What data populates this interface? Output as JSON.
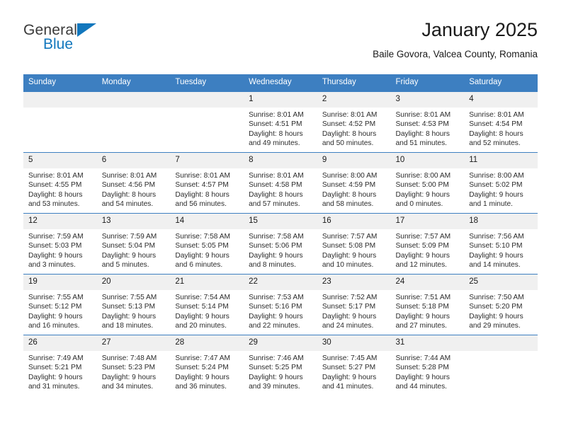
{
  "brand": {
    "name_part1": "General",
    "name_part2": "Blue",
    "triangle_icon": "triangle-icon",
    "accent_color": "#1277bd"
  },
  "header": {
    "title": "January 2025",
    "subtitle": "Baile Govora, Valcea County, Romania"
  },
  "theme": {
    "header_bar_color": "#3d7fc1",
    "daynum_band_color": "#f0f0f0",
    "text_color": "#2b2b2b"
  },
  "calendar": {
    "weekday_headers": [
      "Sunday",
      "Monday",
      "Tuesday",
      "Wednesday",
      "Thursday",
      "Friday",
      "Saturday"
    ],
    "labels": {
      "sunrise": "Sunrise:",
      "sunset": "Sunset:",
      "daylight": "Daylight:"
    },
    "weeks": [
      [
        {
          "day": "",
          "sunrise": "",
          "sunset": "",
          "daylight": "",
          "empty": true
        },
        {
          "day": "",
          "sunrise": "",
          "sunset": "",
          "daylight": "",
          "empty": true
        },
        {
          "day": "",
          "sunrise": "",
          "sunset": "",
          "daylight": "",
          "empty": true
        },
        {
          "day": "1",
          "sunrise": "Sunrise: 8:01 AM",
          "sunset": "Sunset: 4:51 PM",
          "daylight": "Daylight: 8 hours and 49 minutes."
        },
        {
          "day": "2",
          "sunrise": "Sunrise: 8:01 AM",
          "sunset": "Sunset: 4:52 PM",
          "daylight": "Daylight: 8 hours and 50 minutes."
        },
        {
          "day": "3",
          "sunrise": "Sunrise: 8:01 AM",
          "sunset": "Sunset: 4:53 PM",
          "daylight": "Daylight: 8 hours and 51 minutes."
        },
        {
          "day": "4",
          "sunrise": "Sunrise: 8:01 AM",
          "sunset": "Sunset: 4:54 PM",
          "daylight": "Daylight: 8 hours and 52 minutes."
        }
      ],
      [
        {
          "day": "5",
          "sunrise": "Sunrise: 8:01 AM",
          "sunset": "Sunset: 4:55 PM",
          "daylight": "Daylight: 8 hours and 53 minutes."
        },
        {
          "day": "6",
          "sunrise": "Sunrise: 8:01 AM",
          "sunset": "Sunset: 4:56 PM",
          "daylight": "Daylight: 8 hours and 54 minutes."
        },
        {
          "day": "7",
          "sunrise": "Sunrise: 8:01 AM",
          "sunset": "Sunset: 4:57 PM",
          "daylight": "Daylight: 8 hours and 56 minutes."
        },
        {
          "day": "8",
          "sunrise": "Sunrise: 8:01 AM",
          "sunset": "Sunset: 4:58 PM",
          "daylight": "Daylight: 8 hours and 57 minutes."
        },
        {
          "day": "9",
          "sunrise": "Sunrise: 8:00 AM",
          "sunset": "Sunset: 4:59 PM",
          "daylight": "Daylight: 8 hours and 58 minutes."
        },
        {
          "day": "10",
          "sunrise": "Sunrise: 8:00 AM",
          "sunset": "Sunset: 5:00 PM",
          "daylight": "Daylight: 9 hours and 0 minutes."
        },
        {
          "day": "11",
          "sunrise": "Sunrise: 8:00 AM",
          "sunset": "Sunset: 5:02 PM",
          "daylight": "Daylight: 9 hours and 1 minute."
        }
      ],
      [
        {
          "day": "12",
          "sunrise": "Sunrise: 7:59 AM",
          "sunset": "Sunset: 5:03 PM",
          "daylight": "Daylight: 9 hours and 3 minutes."
        },
        {
          "day": "13",
          "sunrise": "Sunrise: 7:59 AM",
          "sunset": "Sunset: 5:04 PM",
          "daylight": "Daylight: 9 hours and 5 minutes."
        },
        {
          "day": "14",
          "sunrise": "Sunrise: 7:58 AM",
          "sunset": "Sunset: 5:05 PM",
          "daylight": "Daylight: 9 hours and 6 minutes."
        },
        {
          "day": "15",
          "sunrise": "Sunrise: 7:58 AM",
          "sunset": "Sunset: 5:06 PM",
          "daylight": "Daylight: 9 hours and 8 minutes."
        },
        {
          "day": "16",
          "sunrise": "Sunrise: 7:57 AM",
          "sunset": "Sunset: 5:08 PM",
          "daylight": "Daylight: 9 hours and 10 minutes."
        },
        {
          "day": "17",
          "sunrise": "Sunrise: 7:57 AM",
          "sunset": "Sunset: 5:09 PM",
          "daylight": "Daylight: 9 hours and 12 minutes."
        },
        {
          "day": "18",
          "sunrise": "Sunrise: 7:56 AM",
          "sunset": "Sunset: 5:10 PM",
          "daylight": "Daylight: 9 hours and 14 minutes."
        }
      ],
      [
        {
          "day": "19",
          "sunrise": "Sunrise: 7:55 AM",
          "sunset": "Sunset: 5:12 PM",
          "daylight": "Daylight: 9 hours and 16 minutes."
        },
        {
          "day": "20",
          "sunrise": "Sunrise: 7:55 AM",
          "sunset": "Sunset: 5:13 PM",
          "daylight": "Daylight: 9 hours and 18 minutes."
        },
        {
          "day": "21",
          "sunrise": "Sunrise: 7:54 AM",
          "sunset": "Sunset: 5:14 PM",
          "daylight": "Daylight: 9 hours and 20 minutes."
        },
        {
          "day": "22",
          "sunrise": "Sunrise: 7:53 AM",
          "sunset": "Sunset: 5:16 PM",
          "daylight": "Daylight: 9 hours and 22 minutes."
        },
        {
          "day": "23",
          "sunrise": "Sunrise: 7:52 AM",
          "sunset": "Sunset: 5:17 PM",
          "daylight": "Daylight: 9 hours and 24 minutes."
        },
        {
          "day": "24",
          "sunrise": "Sunrise: 7:51 AM",
          "sunset": "Sunset: 5:18 PM",
          "daylight": "Daylight: 9 hours and 27 minutes."
        },
        {
          "day": "25",
          "sunrise": "Sunrise: 7:50 AM",
          "sunset": "Sunset: 5:20 PM",
          "daylight": "Daylight: 9 hours and 29 minutes."
        }
      ],
      [
        {
          "day": "26",
          "sunrise": "Sunrise: 7:49 AM",
          "sunset": "Sunset: 5:21 PM",
          "daylight": "Daylight: 9 hours and 31 minutes."
        },
        {
          "day": "27",
          "sunrise": "Sunrise: 7:48 AM",
          "sunset": "Sunset: 5:23 PM",
          "daylight": "Daylight: 9 hours and 34 minutes."
        },
        {
          "day": "28",
          "sunrise": "Sunrise: 7:47 AM",
          "sunset": "Sunset: 5:24 PM",
          "daylight": "Daylight: 9 hours and 36 minutes."
        },
        {
          "day": "29",
          "sunrise": "Sunrise: 7:46 AM",
          "sunset": "Sunset: 5:25 PM",
          "daylight": "Daylight: 9 hours and 39 minutes."
        },
        {
          "day": "30",
          "sunrise": "Sunrise: 7:45 AM",
          "sunset": "Sunset: 5:27 PM",
          "daylight": "Daylight: 9 hours and 41 minutes."
        },
        {
          "day": "31",
          "sunrise": "Sunrise: 7:44 AM",
          "sunset": "Sunset: 5:28 PM",
          "daylight": "Daylight: 9 hours and 44 minutes."
        },
        {
          "day": "",
          "sunrise": "",
          "sunset": "",
          "daylight": "",
          "empty": true
        }
      ]
    ]
  }
}
